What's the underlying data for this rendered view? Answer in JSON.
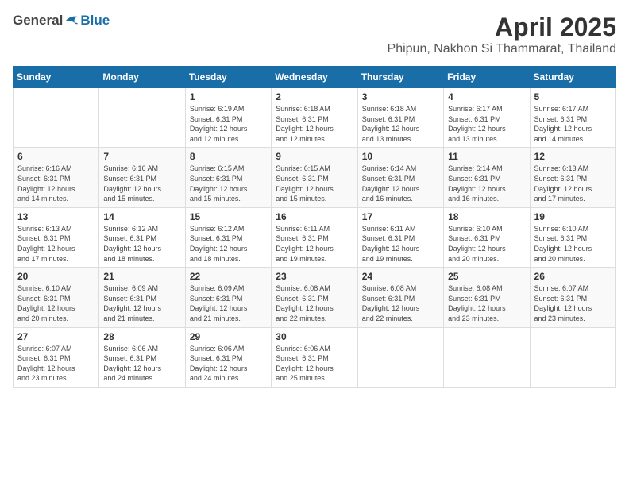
{
  "header": {
    "logo_general": "General",
    "logo_blue": "Blue",
    "month_title": "April 2025",
    "location": "Phipun, Nakhon Si Thammarat, Thailand"
  },
  "days_of_week": [
    "Sunday",
    "Monday",
    "Tuesday",
    "Wednesday",
    "Thursday",
    "Friday",
    "Saturday"
  ],
  "weeks": [
    [
      {
        "day": "",
        "info": ""
      },
      {
        "day": "",
        "info": ""
      },
      {
        "day": "1",
        "info": "Sunrise: 6:19 AM\nSunset: 6:31 PM\nDaylight: 12 hours\nand 12 minutes."
      },
      {
        "day": "2",
        "info": "Sunrise: 6:18 AM\nSunset: 6:31 PM\nDaylight: 12 hours\nand 12 minutes."
      },
      {
        "day": "3",
        "info": "Sunrise: 6:18 AM\nSunset: 6:31 PM\nDaylight: 12 hours\nand 13 minutes."
      },
      {
        "day": "4",
        "info": "Sunrise: 6:17 AM\nSunset: 6:31 PM\nDaylight: 12 hours\nand 13 minutes."
      },
      {
        "day": "5",
        "info": "Sunrise: 6:17 AM\nSunset: 6:31 PM\nDaylight: 12 hours\nand 14 minutes."
      }
    ],
    [
      {
        "day": "6",
        "info": "Sunrise: 6:16 AM\nSunset: 6:31 PM\nDaylight: 12 hours\nand 14 minutes."
      },
      {
        "day": "7",
        "info": "Sunrise: 6:16 AM\nSunset: 6:31 PM\nDaylight: 12 hours\nand 15 minutes."
      },
      {
        "day": "8",
        "info": "Sunrise: 6:15 AM\nSunset: 6:31 PM\nDaylight: 12 hours\nand 15 minutes."
      },
      {
        "day": "9",
        "info": "Sunrise: 6:15 AM\nSunset: 6:31 PM\nDaylight: 12 hours\nand 15 minutes."
      },
      {
        "day": "10",
        "info": "Sunrise: 6:14 AM\nSunset: 6:31 PM\nDaylight: 12 hours\nand 16 minutes."
      },
      {
        "day": "11",
        "info": "Sunrise: 6:14 AM\nSunset: 6:31 PM\nDaylight: 12 hours\nand 16 minutes."
      },
      {
        "day": "12",
        "info": "Sunrise: 6:13 AM\nSunset: 6:31 PM\nDaylight: 12 hours\nand 17 minutes."
      }
    ],
    [
      {
        "day": "13",
        "info": "Sunrise: 6:13 AM\nSunset: 6:31 PM\nDaylight: 12 hours\nand 17 minutes."
      },
      {
        "day": "14",
        "info": "Sunrise: 6:12 AM\nSunset: 6:31 PM\nDaylight: 12 hours\nand 18 minutes."
      },
      {
        "day": "15",
        "info": "Sunrise: 6:12 AM\nSunset: 6:31 PM\nDaylight: 12 hours\nand 18 minutes."
      },
      {
        "day": "16",
        "info": "Sunrise: 6:11 AM\nSunset: 6:31 PM\nDaylight: 12 hours\nand 19 minutes."
      },
      {
        "day": "17",
        "info": "Sunrise: 6:11 AM\nSunset: 6:31 PM\nDaylight: 12 hours\nand 19 minutes."
      },
      {
        "day": "18",
        "info": "Sunrise: 6:10 AM\nSunset: 6:31 PM\nDaylight: 12 hours\nand 20 minutes."
      },
      {
        "day": "19",
        "info": "Sunrise: 6:10 AM\nSunset: 6:31 PM\nDaylight: 12 hours\nand 20 minutes."
      }
    ],
    [
      {
        "day": "20",
        "info": "Sunrise: 6:10 AM\nSunset: 6:31 PM\nDaylight: 12 hours\nand 20 minutes."
      },
      {
        "day": "21",
        "info": "Sunrise: 6:09 AM\nSunset: 6:31 PM\nDaylight: 12 hours\nand 21 minutes."
      },
      {
        "day": "22",
        "info": "Sunrise: 6:09 AM\nSunset: 6:31 PM\nDaylight: 12 hours\nand 21 minutes."
      },
      {
        "day": "23",
        "info": "Sunrise: 6:08 AM\nSunset: 6:31 PM\nDaylight: 12 hours\nand 22 minutes."
      },
      {
        "day": "24",
        "info": "Sunrise: 6:08 AM\nSunset: 6:31 PM\nDaylight: 12 hours\nand 22 minutes."
      },
      {
        "day": "25",
        "info": "Sunrise: 6:08 AM\nSunset: 6:31 PM\nDaylight: 12 hours\nand 23 minutes."
      },
      {
        "day": "26",
        "info": "Sunrise: 6:07 AM\nSunset: 6:31 PM\nDaylight: 12 hours\nand 23 minutes."
      }
    ],
    [
      {
        "day": "27",
        "info": "Sunrise: 6:07 AM\nSunset: 6:31 PM\nDaylight: 12 hours\nand 23 minutes."
      },
      {
        "day": "28",
        "info": "Sunrise: 6:06 AM\nSunset: 6:31 PM\nDaylight: 12 hours\nand 24 minutes."
      },
      {
        "day": "29",
        "info": "Sunrise: 6:06 AM\nSunset: 6:31 PM\nDaylight: 12 hours\nand 24 minutes."
      },
      {
        "day": "30",
        "info": "Sunrise: 6:06 AM\nSunset: 6:31 PM\nDaylight: 12 hours\nand 25 minutes."
      },
      {
        "day": "",
        "info": ""
      },
      {
        "day": "",
        "info": ""
      },
      {
        "day": "",
        "info": ""
      }
    ]
  ]
}
